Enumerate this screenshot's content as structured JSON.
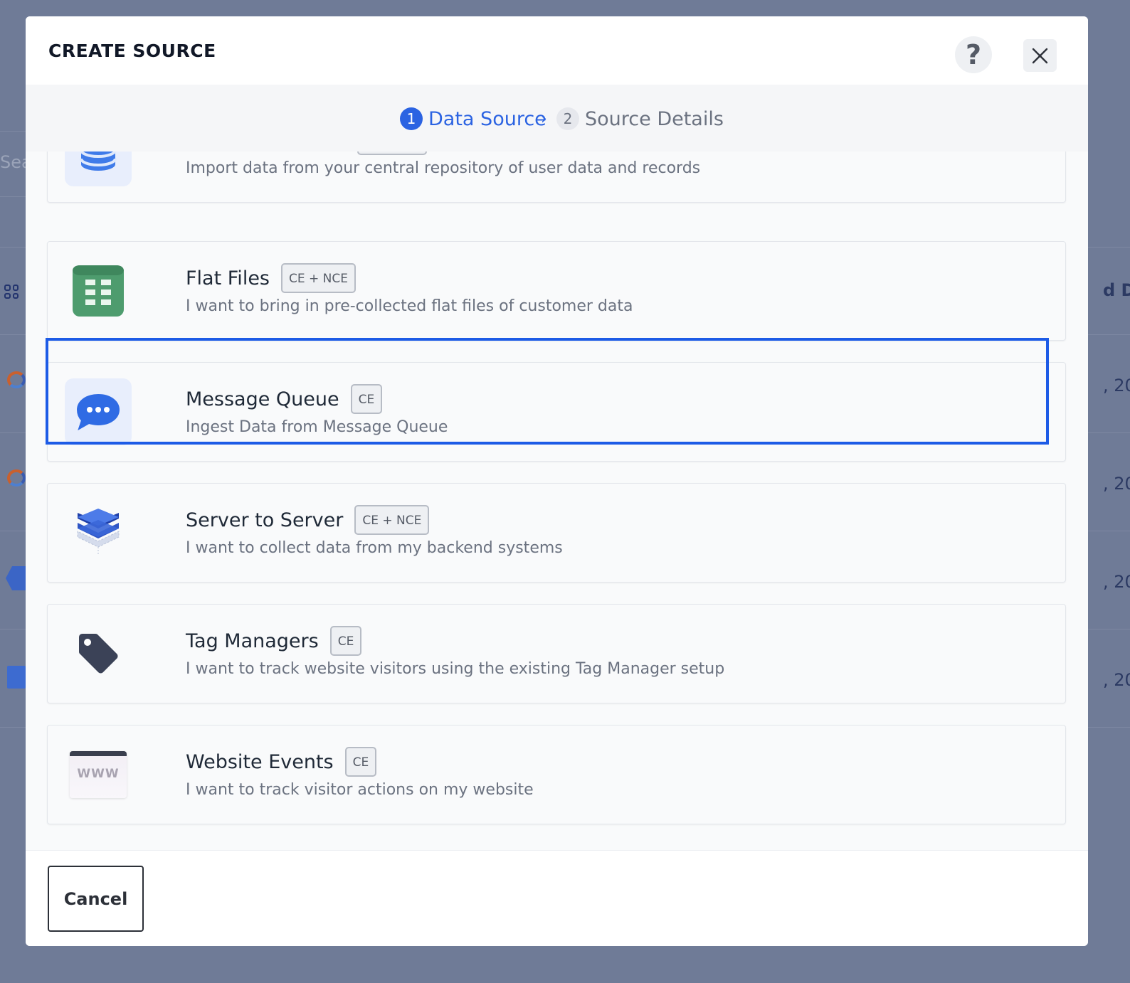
{
  "background": {
    "search_fragment": "Sea",
    "right_fragments": [
      "d Da",
      ", 20",
      ", 20",
      ", 20",
      ", 20"
    ]
  },
  "modal": {
    "title": "CREATE SOURCE",
    "help_label": "?",
    "stepper": {
      "steps": [
        {
          "number": "1",
          "label": "Data Source",
          "state": "active"
        },
        {
          "number": "2",
          "label": "Source Details",
          "state": "inactive"
        }
      ],
      "separator": "›"
    },
    "sources": [
      {
        "title": "",
        "badge": "",
        "description": "Import data from your central repository of user data and records",
        "icon": "database-icon"
      },
      {
        "title": "Flat Files",
        "badge": "CE + NCE",
        "description": "I want to bring in pre-collected flat files of customer data",
        "icon": "spreadsheet-icon"
      },
      {
        "title": "Message Queue",
        "badge": "CE",
        "description": "Ingest Data from Message Queue",
        "icon": "chat-bubble-icon",
        "selected": true
      },
      {
        "title": "Server to Server",
        "badge": "CE + NCE",
        "description": "I want to collect data from my backend systems",
        "icon": "server-stack-icon"
      },
      {
        "title": "Tag Managers",
        "badge": "CE",
        "description": "I want to track website visitors using the existing Tag Manager setup",
        "icon": "tag-icon"
      },
      {
        "title": "Website Events",
        "badge": "CE",
        "description": "I want to track visitor actions on my website",
        "icon": "browser-www-icon",
        "icon_text": "WWW"
      }
    ],
    "footer": {
      "cancel_label": "Cancel"
    }
  },
  "colors": {
    "accent": "#2b63e2",
    "selection": "#1d5be6",
    "overlay": "#6f7b97"
  }
}
